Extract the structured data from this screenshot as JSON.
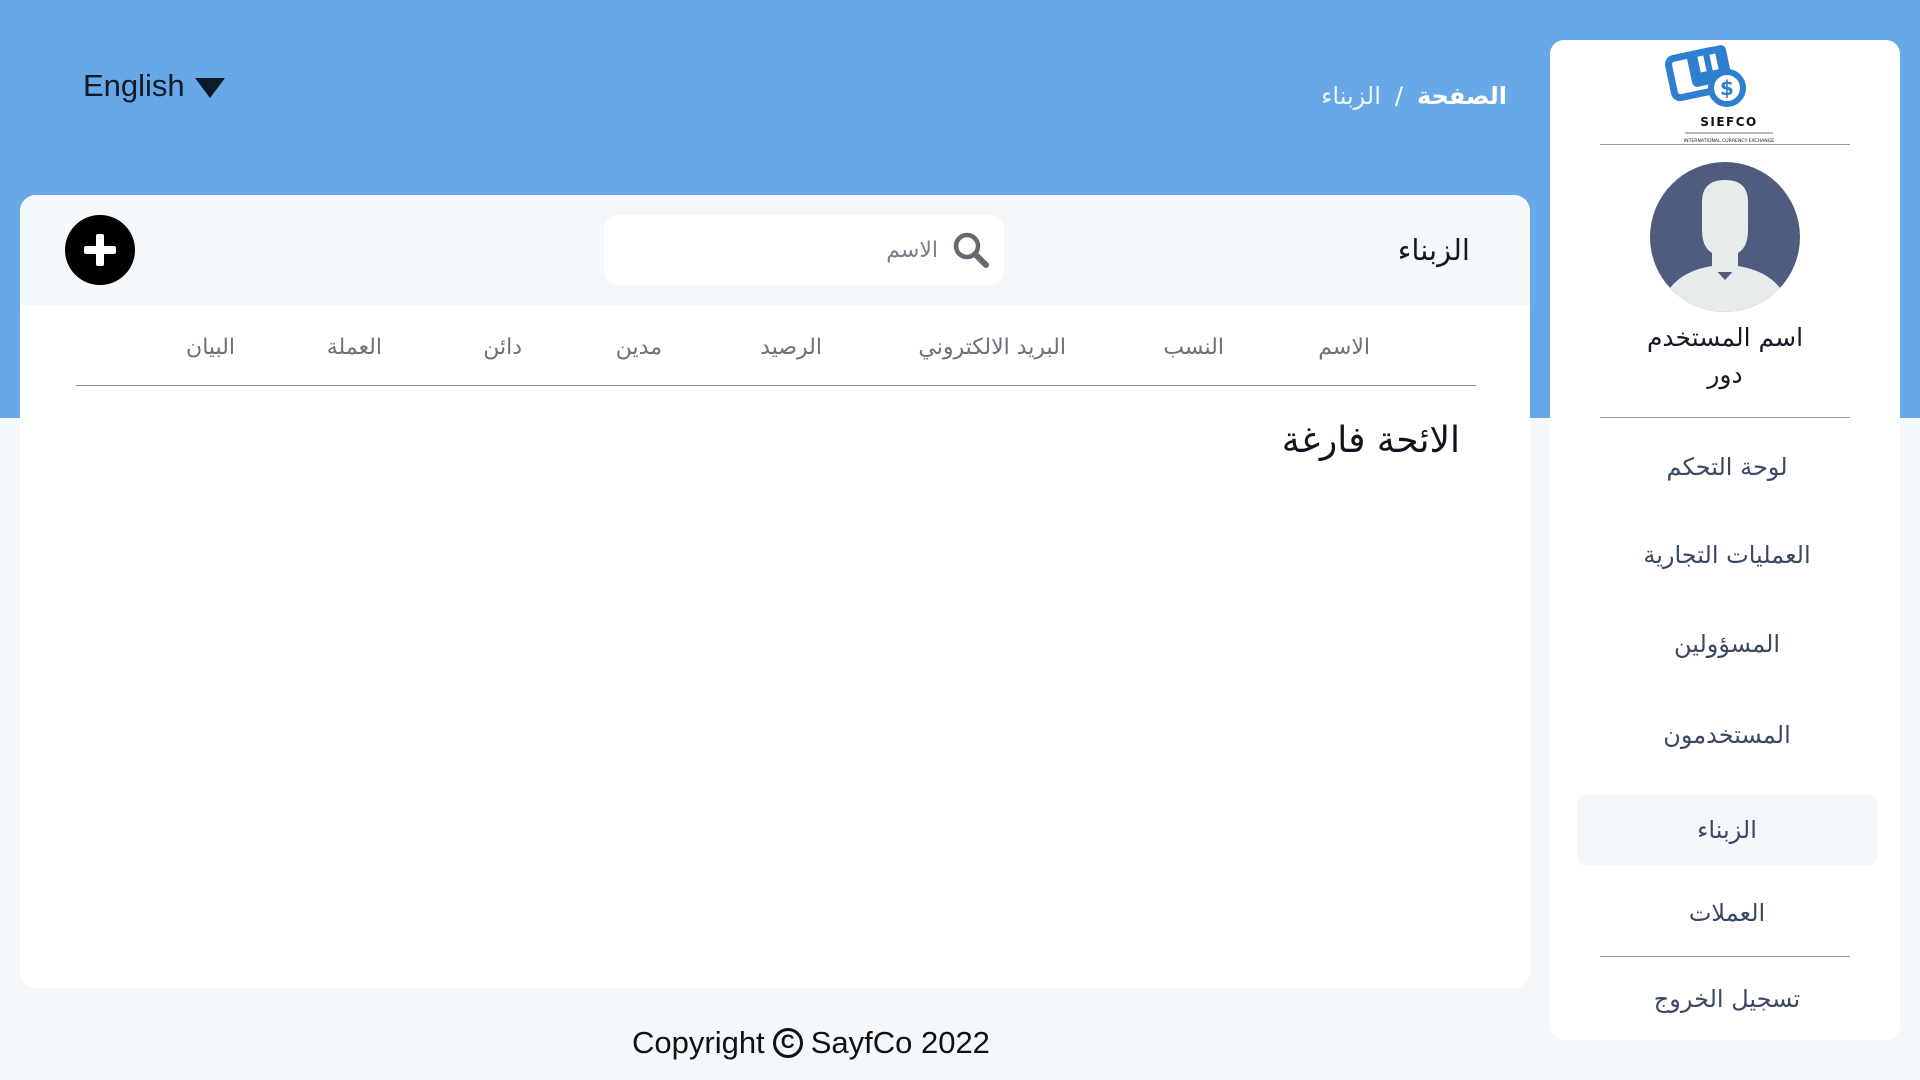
{
  "language": {
    "selected": "English"
  },
  "breadcrumb": {
    "home": "الصفحة",
    "separator": "/",
    "current": "الزبناء"
  },
  "card": {
    "title": "الزبناء",
    "search_placeholder": "الاسم",
    "add_icon": "plus-circle-icon",
    "columns": [
      "الاسم",
      "النسب",
      "البريد الالكتروني",
      "الرصيد",
      "مدين",
      "دائن",
      "العملة",
      "البيان"
    ],
    "empty_message": "الائحة فارغة"
  },
  "sidebar": {
    "logo_text": "SIEFCO",
    "logo_subtext": "INTERNATIONAL CURRENCY EXCHANGE",
    "user_name": "اسم المستخدم",
    "user_role": "دور",
    "items": [
      {
        "label": "لوحة التحكم",
        "active": false
      },
      {
        "label": "العمليات التجارية",
        "active": false
      },
      {
        "label": "المسؤولين",
        "active": false
      },
      {
        "label": "المستخدمون",
        "active": false
      },
      {
        "label": "الزبناء",
        "active": true
      },
      {
        "label": "العملات",
        "active": false
      }
    ],
    "logout": "تسجيل الخروج"
  },
  "footer": {
    "text": "SayfCo 2022",
    "prefix": "Copyright"
  },
  "colors": {
    "header_bg": "#68a8e6",
    "page_bg": "#f5f8fb",
    "nav_text": "#3b4863",
    "brand_blue": "#2f7fd0"
  }
}
